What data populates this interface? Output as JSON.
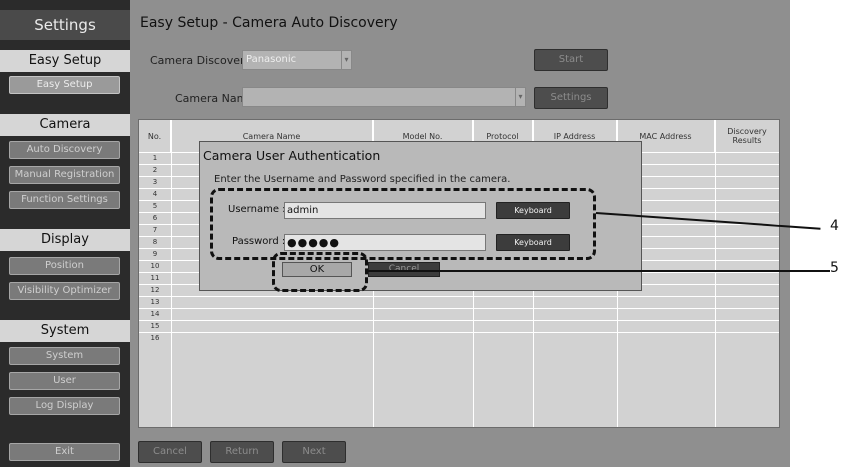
{
  "sidebar": {
    "title": "Settings",
    "sections": [
      {
        "heading": "Easy Setup",
        "items": [
          "Easy Setup"
        ]
      },
      {
        "heading": "Camera",
        "items": [
          "Auto Discovery",
          "Manual Registration",
          "Function Settings"
        ]
      },
      {
        "heading": "Display",
        "items": [
          "Position",
          "Visibility Optimizer"
        ]
      },
      {
        "heading": "System",
        "items": [
          "System",
          "User",
          "Log Display"
        ]
      }
    ],
    "exit_label": "Exit"
  },
  "page": {
    "title": "Easy Setup - Camera Auto Discovery"
  },
  "discovery": {
    "label": "Camera Discovery",
    "selected": "Panasonic",
    "start_label": "Start",
    "camera_name_label": "Camera Name",
    "settings_label": "Settings"
  },
  "table": {
    "columns": [
      "No.",
      "Camera Name",
      "Model No.",
      "Protocol",
      "IP Address",
      "MAC Address",
      "Discovery Results"
    ],
    "row_numbers": [
      "1",
      "2",
      "3",
      "4",
      "5",
      "6",
      "7",
      "8",
      "9",
      "10",
      "11",
      "12",
      "13",
      "14",
      "15",
      "16"
    ]
  },
  "dialog": {
    "title": "Camera User Authentication",
    "instruction": "Enter the Username and Password specified in the camera.",
    "username_label": "Username :",
    "username_value": "admin",
    "password_label": "Password :",
    "password_value": "●●●●●",
    "keyboard_label": "Keyboard",
    "ok_label": "OK",
    "cancel_label": "Cancel"
  },
  "footer": {
    "cancel_label": "Cancel",
    "return_label": "Return",
    "next_label": "Next"
  },
  "callouts": {
    "fields": "4",
    "ok": "5"
  }
}
